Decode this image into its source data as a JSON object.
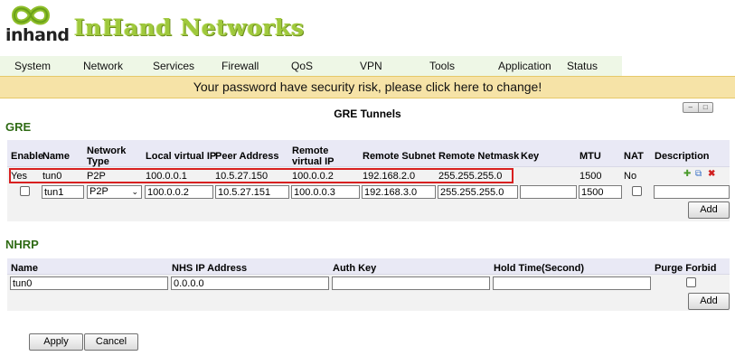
{
  "header": {
    "logo_text": "inhand",
    "brand": "InHand Networks"
  },
  "nav": {
    "items": [
      {
        "label": "System"
      },
      {
        "label": "Network"
      },
      {
        "label": "Services"
      },
      {
        "label": "Firewall"
      },
      {
        "label": "QoS"
      },
      {
        "label": "VPN"
      },
      {
        "label": "Tools"
      },
      {
        "label": "Application"
      },
      {
        "label": "Status"
      }
    ]
  },
  "alert": {
    "text": "Your password have security risk, please click here to change!"
  },
  "gre": {
    "section_label": "GRE",
    "title": "GRE Tunnels",
    "columns": [
      "Enable",
      "Name",
      "Network Type",
      "Local virtual IP",
      "Peer Address",
      "Remote virtual IP",
      "Remote Subnet",
      "Remote Netmask",
      "Key",
      "MTU",
      "NAT",
      "Description"
    ],
    "row": {
      "enable": "Yes",
      "name": "tun0",
      "network_type": "P2P",
      "local_virtual_ip": "100.0.0.1",
      "peer_address": "10.5.27.150",
      "remote_virtual_ip": "100.0.0.2",
      "remote_subnet": "192.168.2.0",
      "remote_netmask": "255.255.255.0",
      "key": "",
      "mtu": "1500",
      "nat": "No",
      "description": ""
    },
    "new_row": {
      "name": "tun1",
      "network_type": "P2P",
      "local_virtual_ip": "100.0.0.2",
      "peer_address": "10.5.27.151",
      "remote_virtual_ip": "100.0.0.3",
      "remote_subnet": "192.168.3.0",
      "remote_netmask": "255.255.255.0",
      "key": "",
      "mtu": "1500",
      "description": ""
    },
    "add_label": "Add"
  },
  "nhrp": {
    "section_label": "NHRP",
    "columns": [
      "Name",
      "NHS IP Address",
      "Auth Key",
      "Hold Time(Second)",
      "Purge Forbid"
    ],
    "new_row": {
      "name": "tun0",
      "nhs_ip": "0.0.0.0",
      "auth_key": "",
      "hold_time": ""
    },
    "add_label": "Add"
  },
  "footer": {
    "apply_label": "Apply",
    "cancel_label": "Cancel"
  },
  "colors": {
    "brand_green": "#9fc93c",
    "section_green": "#2f6b14",
    "alert_bg": "#f6e3a7",
    "highlight_red": "#d82020"
  }
}
